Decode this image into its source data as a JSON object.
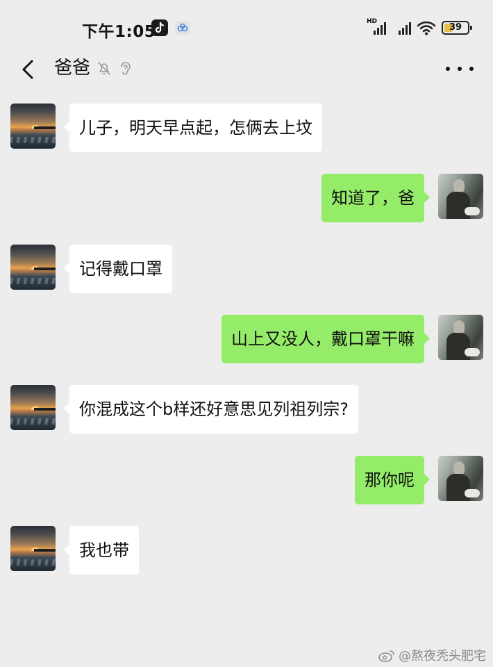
{
  "status_bar": {
    "time": "下午1:05",
    "network_label": "HD",
    "battery_level": "39",
    "battery_fraction": 0.39,
    "icons": [
      "tiktok-icon",
      "cloud-icon",
      "signal-icon",
      "wifi-icon",
      "battery-icon"
    ]
  },
  "header": {
    "title": "爸爸",
    "icons": [
      "back-chevron-icon",
      "mute-bell-icon",
      "ear-icon",
      "more-dots-icon"
    ]
  },
  "colors": {
    "background": "#ededed",
    "received_bubble": "#ffffff",
    "sent_bubble": "#95ec69",
    "battery_fill": "#e6c14a"
  },
  "messages": [
    {
      "sender": "dad",
      "side": "left",
      "text": "儿子，明天早点起，怎俩去上坟"
    },
    {
      "sender": "me",
      "side": "right",
      "text": "知道了，爸"
    },
    {
      "sender": "dad",
      "side": "left",
      "text": "记得戴口罩"
    },
    {
      "sender": "me",
      "side": "right",
      "text": "山上又没人，戴口罩干嘛"
    },
    {
      "sender": "dad",
      "side": "left",
      "text": "你混成这个b样还好意思见列祖列宗?"
    },
    {
      "sender": "me",
      "side": "right",
      "text": "那你呢"
    },
    {
      "sender": "dad",
      "side": "left",
      "text": "我也带"
    }
  ],
  "watermark": {
    "text": "@熬夜秃头肥宅",
    "icon": "weibo-icon"
  }
}
